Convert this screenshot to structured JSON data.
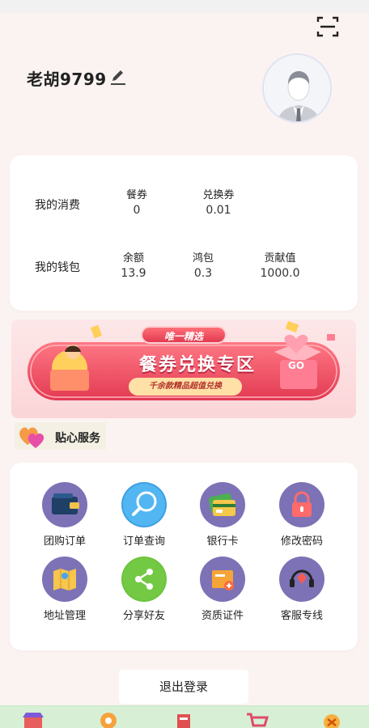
{
  "profile": {
    "username": "老胡9799"
  },
  "wallet_card": {
    "consumption_label": "我的消费",
    "wallet_label": "我的钱包",
    "consumption_stats": [
      {
        "label": "餐券",
        "value": "0"
      },
      {
        "label": "兑换券",
        "value": "0.01"
      }
    ],
    "wallet_stats": [
      {
        "label": "余额",
        "value": "13.9"
      },
      {
        "label": "鸿包",
        "value": "0.3"
      },
      {
        "label": "贡献值",
        "value": "1000.0"
      }
    ]
  },
  "banner": {
    "tag": "唯一精选",
    "title": "餐券兑换专区",
    "subtitle": "千余款精品超值兑换",
    "go": "GO"
  },
  "services": {
    "title": "贴心服务",
    "items": [
      {
        "label": "团购订单",
        "icon": "wallet-icon"
      },
      {
        "label": "订单查询",
        "icon": "search-icon"
      },
      {
        "label": "银行卡",
        "icon": "bank-card-icon"
      },
      {
        "label": "修改密码",
        "icon": "lock-icon"
      },
      {
        "label": "地址管理",
        "icon": "map-icon"
      },
      {
        "label": "分享好友",
        "icon": "share-icon"
      },
      {
        "label": "资质证件",
        "icon": "certificate-icon"
      },
      {
        "label": "客服专线",
        "icon": "headset-icon"
      }
    ]
  },
  "logout_label": "退出登录",
  "colors": {
    "background": "#fbf3f2",
    "icon_purple": "#7f73b8",
    "banner_red": "#ec4a5e",
    "bottom_bar": "#d7f0d5"
  }
}
